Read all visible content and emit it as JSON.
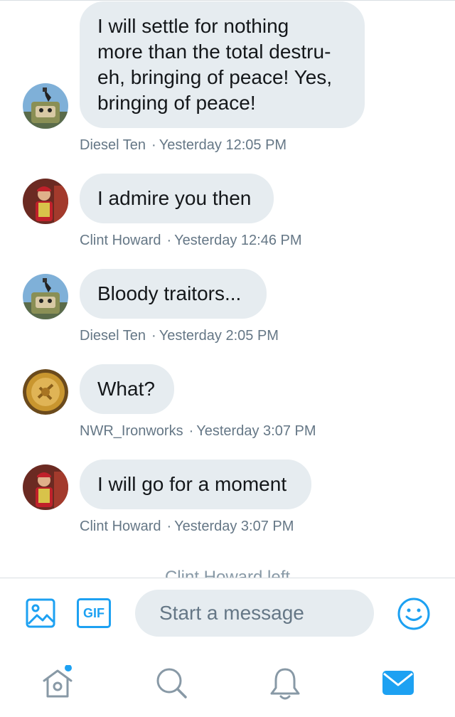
{
  "messages": [
    {
      "author": "Diesel Ten",
      "text": "I will settle for nothing\nmore than the total destru-\neh, bringing of peace! Yes,\nbringing of peace!",
      "time": "Yesterday 12:05 PM",
      "avatar_icon": "diesel-ten-avatar"
    },
    {
      "author": "Clint Howard",
      "text": "I admire you then",
      "time": "Yesterday 12:46 PM",
      "avatar_icon": "clint-howard-avatar"
    },
    {
      "author": "Diesel Ten",
      "text": "Bloody traitors...",
      "time": "Yesterday 2:05 PM",
      "avatar_icon": "diesel-ten-avatar"
    },
    {
      "author": "NWR_Ironworks",
      "text": "What?",
      "time": "Yesterday 3:07 PM",
      "avatar_icon": "nwr-ironworks-avatar"
    },
    {
      "author": "Clint Howard",
      "text": "I will go for a moment",
      "time": "Yesterday 3:07 PM",
      "avatar_icon": "clint-howard-avatar"
    }
  ],
  "separator": "·",
  "left_notice": "Clint Howard left",
  "composer": {
    "placeholder": "Start a message",
    "gif_label": "GIF",
    "icons": [
      "image-icon",
      "gif-icon",
      "emoji-icon"
    ]
  },
  "tabbar": {
    "icons": [
      "home-icon",
      "search-icon",
      "notifications-icon",
      "messages-icon"
    ],
    "has_home_badge": true
  },
  "colors": {
    "accent": "#1da1f2",
    "bubble": "#e6ecf0",
    "meta_text": "#657786",
    "tab_inactive": "#8899a6"
  }
}
